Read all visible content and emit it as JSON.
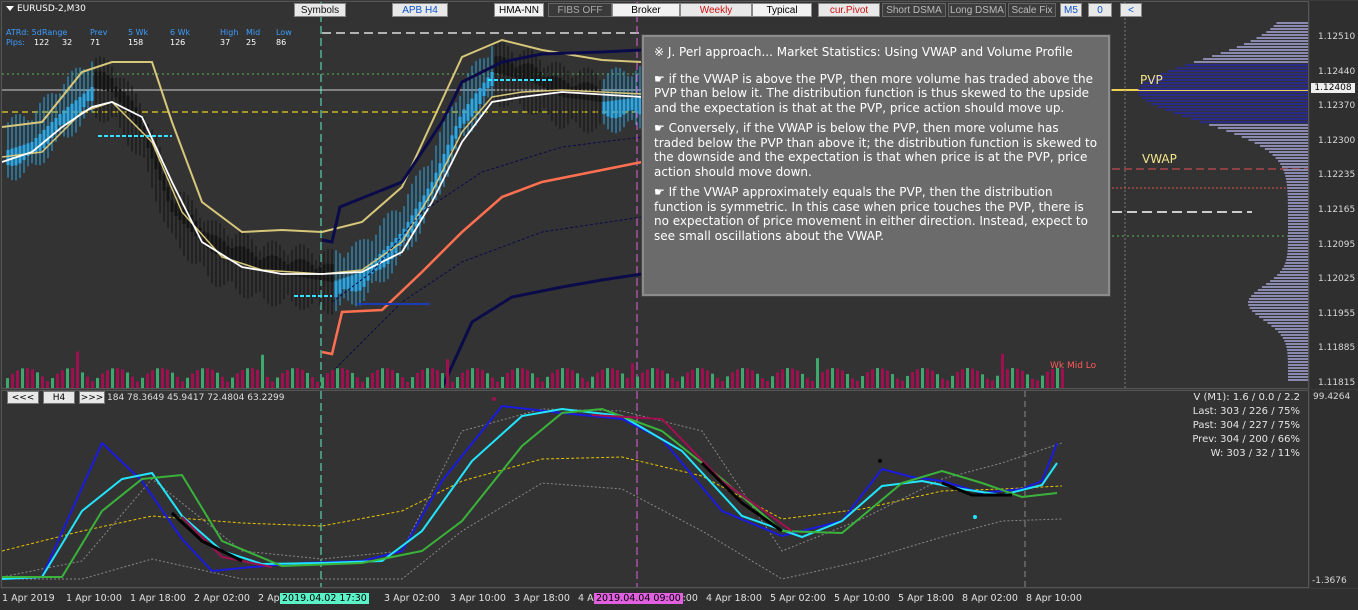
{
  "chart": {
    "symbol": "EURUSD-2,M30",
    "stats_headers": [
      "ATRd: 5d",
      "Range",
      "Prev",
      "5 Wk",
      "6 Wk",
      "High",
      "Mid",
      "Low"
    ],
    "stats_label": "Pips:",
    "stats_values": [
      "122",
      "32",
      "71",
      "158",
      "126",
      "37",
      "25",
      "86"
    ]
  },
  "toolbar": {
    "buttons": [
      "Symbols",
      "APB H4",
      "HMA-NN",
      "FIBS OFF",
      "Broker",
      "Weekly",
      "Typical",
      "cur.Pivot",
      "Short DSMA",
      "Long DSMA",
      "Scale Fix",
      "M5",
      "0",
      "<"
    ]
  },
  "note": {
    "title": "※ J. Perl approach...  Market Statistics:  Using VWAP and Volume Profile",
    "p1": "☛ if the VWAP is above the PVP, then more volume has traded above the PVP than below it. The distribution function is thus skewed to the upside and the expectation is that at the PVP, price action should move up.",
    "p2": "☛ Conversely, if the VWAP is below the PVP, then more volume has traded below the PVP than above it; the distribution function is skewed to the downside and the expectation is that when price is at the PVP, price action should move down.",
    "p3": "☛ If the VWAP approximately equals the PVP, then the distribution function is symmetric. In this case when price touches the PVP, there is no expectation of price movement in either direction. Instead, expect to see small oscillations about the VWAP."
  },
  "labels": {
    "pvp": "PVP",
    "vwap": "VWAP",
    "wk_mid_lo": "Wk Mid Lo",
    "current_price": "1.12408"
  },
  "price_axis": [
    "1.12510",
    "1.12440",
    "1.12370",
    "1.12300",
    "1.12235",
    "1.12165",
    "1.12095",
    "1.12025",
    "1.11955",
    "1.11885",
    "1.11815"
  ],
  "indicator": {
    "nav": [
      "<<<",
      "H4",
      ">>>"
    ],
    "values": "184 78.3649 45.9417 72.4804 63.2299",
    "axis_top": "99.4264",
    "axis_bottom": "-1.3676",
    "stats": [
      "V (M1): 1.6 / 0.0 / 2.2",
      "Last: 303 / 226 / 75%",
      "Past: 304 / 227 / 75%",
      "Prev: 304 / 200 / 66%",
      "W: 303 / 32 / 11%"
    ]
  },
  "time_axis": [
    "1 Apr 2019",
    "1 Apr 10:00",
    "1 Apr 18:00",
    "2 Apr 02:00",
    "2 Apr 10:00",
    "3 Apr 02:00",
    "3 Apr 10:00",
    "3 Apr 18:00",
    "4 Apr 02:00",
    "4 Apr 10:00",
    "4 Apr 18:00",
    "5 Apr 02:00",
    "5 Apr 10:00",
    "5 Apr 18:00",
    "8 Apr 02:00",
    "8 Apr 10:00"
  ],
  "crosshair_dates": [
    "2019.04.02 17:30",
    "2019.04.04 09:00"
  ],
  "colors": {
    "cyan_marker": "#5cf2c8",
    "magenta_marker": "#e060e0",
    "up_bar": "#29a8e8",
    "down_bar": "#1a1a1a",
    "vwap_line": "#ff7050",
    "upper_band": "#0b0b4a"
  }
}
